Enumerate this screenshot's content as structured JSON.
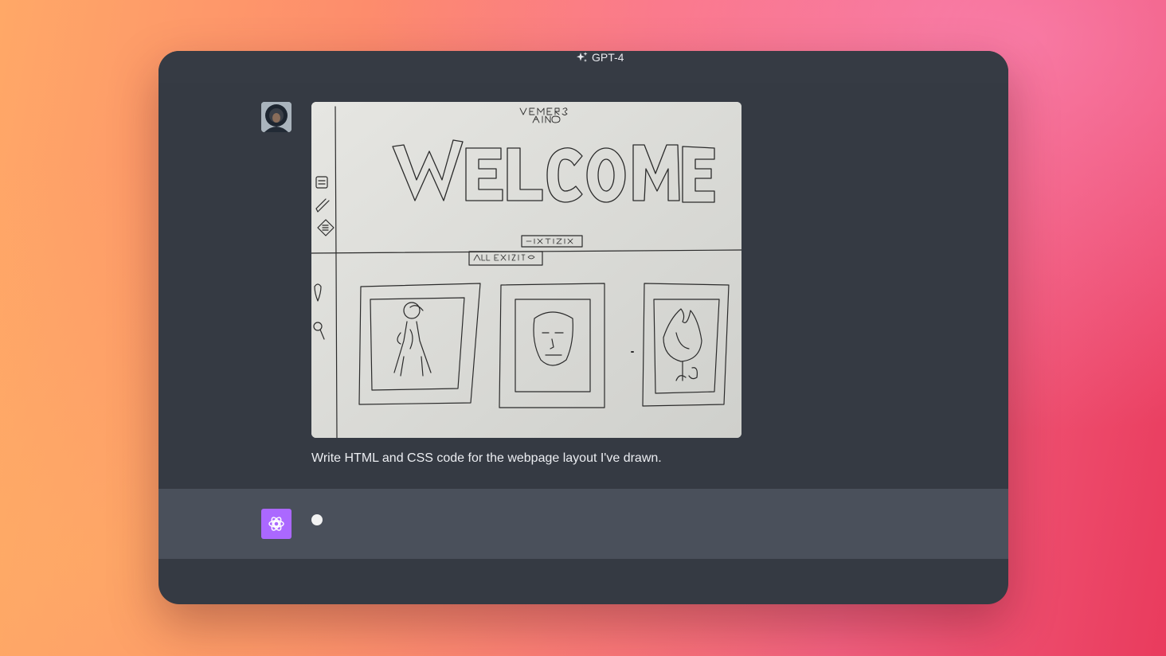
{
  "header": {
    "model_name": "GPT-4",
    "model_icon": "sparkle-icon"
  },
  "user_turn": {
    "avatar": "user-avatar",
    "attachment": {
      "kind": "photo of hand-drawn webpage sketch",
      "sketch_heading": "WELCOME",
      "sketch_top_text_line1": "MEMBERS",
      "sketch_top_text_line2": "AINO",
      "sketch_button_1": "BUY TICKETS",
      "sketch_button_2": "ALL EXHIBITIONS"
    },
    "message": "Write HTML and CSS code for the webpage layout I've drawn."
  },
  "assistant_turn": {
    "avatar": "openai-logo-icon",
    "status": "typing-indicator"
  },
  "colors": {
    "window_bg": "#353a43",
    "assistant_row_bg": "#4a505b",
    "assistant_avatar_bg": "#ab68ff",
    "text": "#eceef2"
  }
}
